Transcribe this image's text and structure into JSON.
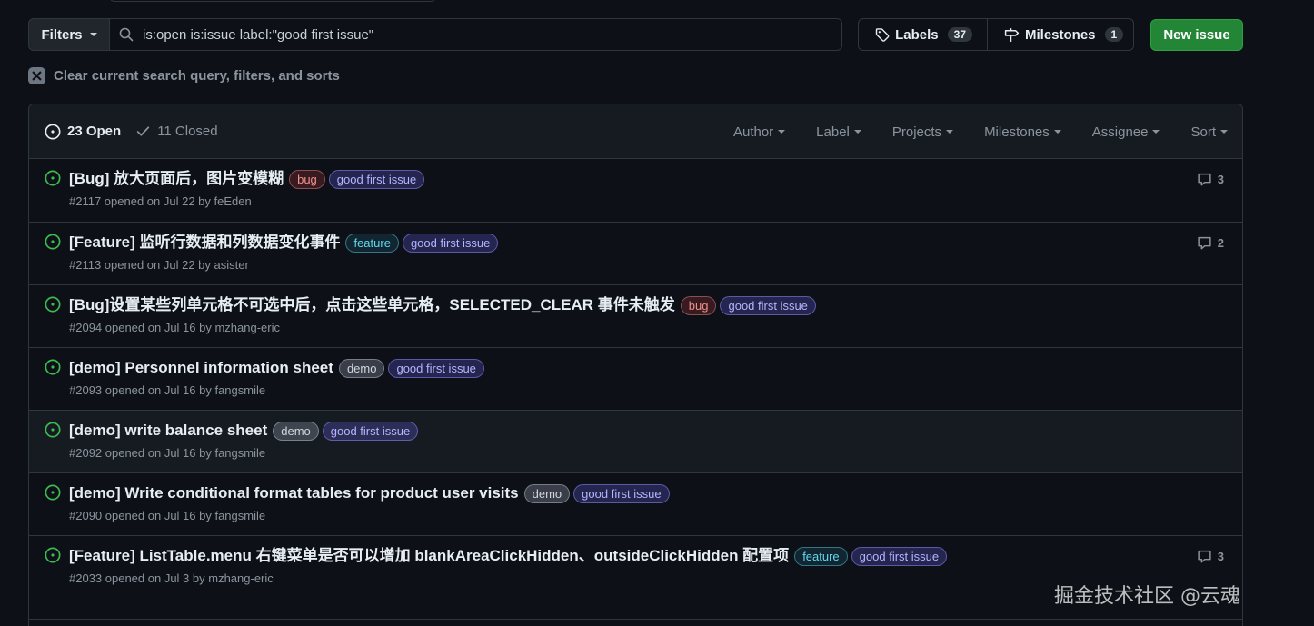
{
  "filters": {
    "label": "Filters"
  },
  "search": {
    "value": "is:open is:issue label:\"good first issue\""
  },
  "labels_button": {
    "label": "Labels",
    "count": "37"
  },
  "milestones_button": {
    "label": "Milestones",
    "count": "1"
  },
  "new_issue": {
    "label": "New issue"
  },
  "clear": {
    "label": "Clear current search query, filters, and sorts"
  },
  "states": {
    "open": "23 Open",
    "closed": "11 Closed"
  },
  "header_filters": [
    "Author",
    "Label",
    "Projects",
    "Milestones",
    "Assignee",
    "Sort"
  ],
  "label_styles": {
    "bug": {
      "color": "#f0918a",
      "bg": "rgba(215,58,74,0.22)",
      "border": "rgba(240,145,138,0.45)"
    },
    "feature": {
      "color": "#61d8ef",
      "bg": "rgba(38,164,199,0.15)",
      "border": "rgba(97,216,239,0.45)"
    },
    "good first issue": {
      "color": "#b8b3ff",
      "bg": "rgba(112,102,246,0.25)",
      "border": "rgba(150,140,255,0.5)"
    },
    "demo": {
      "color": "#d2d6dc",
      "bg": "rgba(160,170,185,0.3)",
      "border": "rgba(180,190,200,0.5)"
    }
  },
  "issues": [
    {
      "title": "[Bug] 放大页面后，图片变模糊",
      "labels": [
        "bug",
        "good first issue"
      ],
      "meta": "#2117 opened on Jul 22 by feEden",
      "comments": "3",
      "height": 70
    },
    {
      "title": "[Feature] 监听行数据和列数据变化事件",
      "labels": [
        "feature",
        "good first issue"
      ],
      "meta": "#2113 opened on Jul 22 by asister",
      "comments": "2",
      "height": 69
    },
    {
      "title": "[Bug]设置某些列单元格不可选中后，点击这些单元格，SELECTED_CLEAR 事件未触发",
      "labels": [
        "bug",
        "good first issue"
      ],
      "meta": "#2094 opened on Jul 16 by mzhang-eric",
      "comments": "",
      "height": 69
    },
    {
      "title": "[demo] Personnel information sheet",
      "labels": [
        "demo",
        "good first issue"
      ],
      "meta": "#2093 opened on Jul 16 by fangsmile",
      "comments": "",
      "height": 69
    },
    {
      "title": "[demo] write balance sheet",
      "labels": [
        "demo",
        "good first issue"
      ],
      "meta": "#2092 opened on Jul 16 by fangsmile",
      "comments": "",
      "height": 69,
      "highlight": true
    },
    {
      "title": "[demo] Write conditional format tables for product user visits",
      "labels": [
        "demo",
        "good first issue"
      ],
      "meta": "#2090 opened on Jul 16 by fangsmile",
      "comments": "",
      "height": 69
    },
    {
      "title": "[Feature] ListTable.menu 右键菜单是否可以增加 blankAreaClickHidden、outsideClickHidden 配置项",
      "labels": [
        "feature",
        "good first issue"
      ],
      "meta": "#2033 opened on Jul 3 by mzhang-eric",
      "comments": "3",
      "height": 92
    }
  ],
  "watermark": "掘金技术社区 @云魂"
}
